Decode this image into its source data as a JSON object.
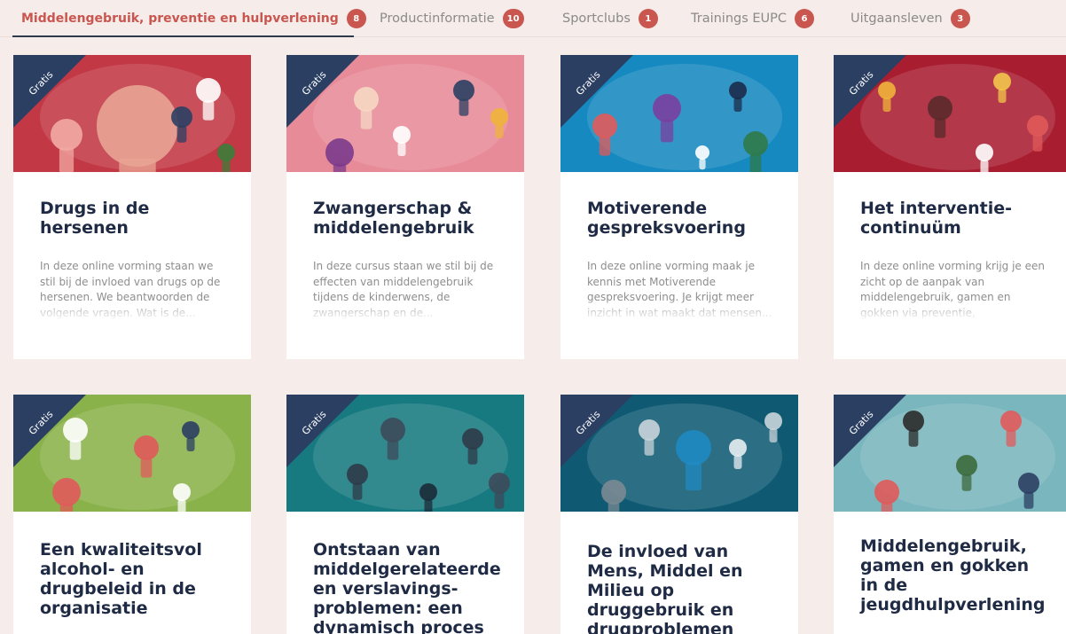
{
  "tabs": [
    {
      "label": "Middelengebruik, preventie en hulpverlening",
      "count": "8"
    },
    {
      "label": "Productinformatie",
      "count": "10"
    },
    {
      "label": "Sportclubs",
      "count": "1"
    },
    {
      "label": "Trainings EUPC",
      "count": "6"
    },
    {
      "label": "Uitgaansleven",
      "count": "3"
    }
  ],
  "ribbon_label": "Gratis",
  "colors": {
    "accent": "#c9564f",
    "ribbon": "#2b3f63",
    "title": "#1f2a44",
    "background": "#f6ece9"
  },
  "cards": [
    {
      "title": "Drugs in de hersenen",
      "description": "In deze online vorming staan we stil bij de invloed van drugs op de hersenen. We beantwoorden de volgende vragen. Wat is de...",
      "image_color": "#c23845"
    },
    {
      "title": "Zwangerschap & middelengebruik",
      "description": "In deze cursus staan we stil bij de effecten van middelengebruik tijdens de kinderwens, de zwangerschap en de...",
      "image_color": "#e88b98"
    },
    {
      "title": "Motiverende gespreksvoering",
      "description": "In deze online vorming maak je kennis met Motiverende gespreksvoering. Je krijgt meer inzicht in wat maakt dat mensen...",
      "image_color": "#1689c0"
    },
    {
      "title": "Het interventie-continuüm",
      "description": "In deze online vorming krijg je een zicht op de aanpak van middelengebruik, gamen en gokken via preventie, vroeginterventie en...",
      "image_color": "#a91d31"
    },
    {
      "title": "Een kwaliteitsvol alcohol- en drugbeleid in de organisatie",
      "description": "",
      "image_color": "#8ab24a"
    },
    {
      "title": "Ontstaan van middelgerelateerde en verslavings-problemen: een dynamisch proces",
      "description": "",
      "image_color": "#167a80"
    },
    {
      "title": "De invloed van Mens, Middel en Milieu op druggebruik en drugproblemen",
      "description": "",
      "image_color": "#0f5a72"
    },
    {
      "title": "Middelengebruik, gamen en gokken in de jeugdhulpverlening",
      "description": "",
      "image_color": "#7ab6bd"
    }
  ]
}
